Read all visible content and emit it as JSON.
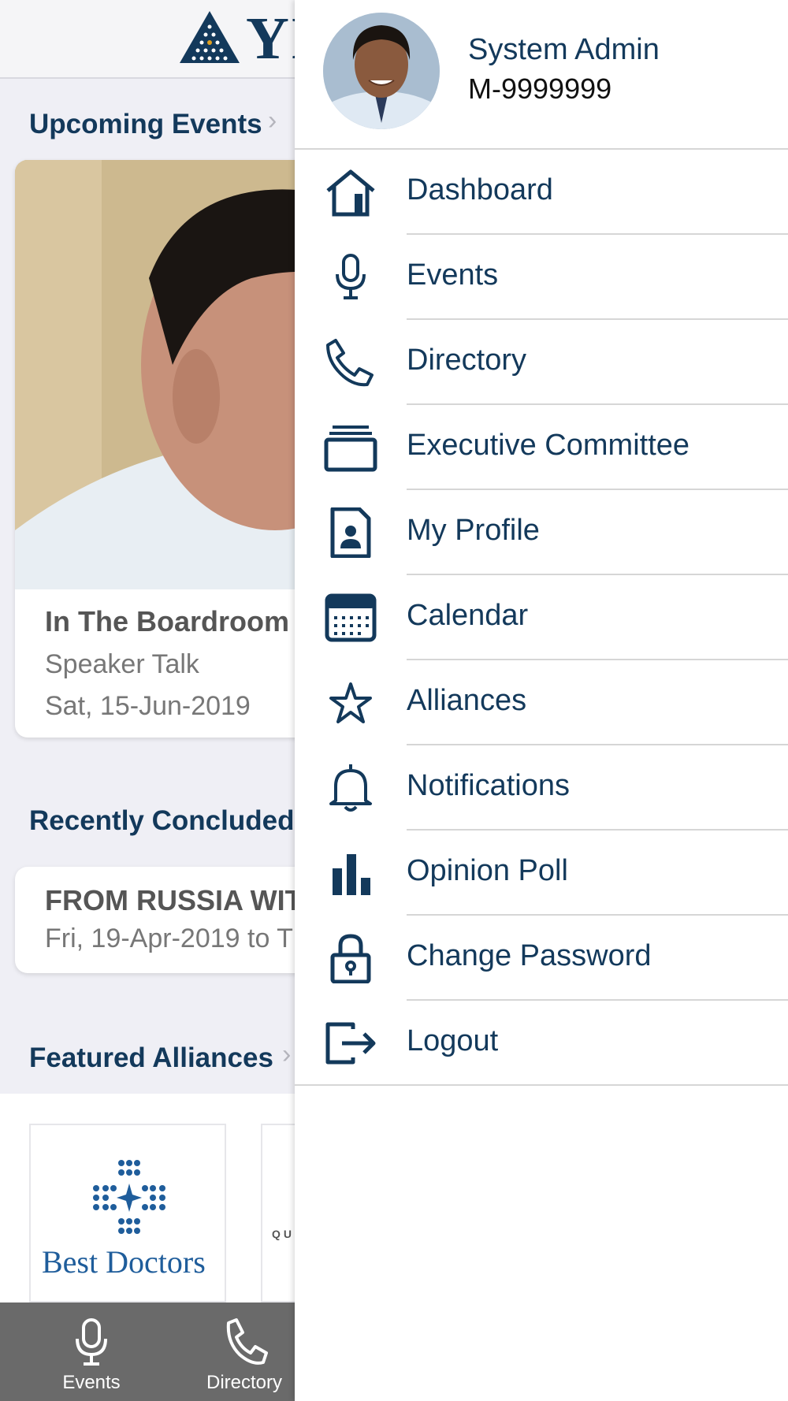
{
  "app": {
    "logo_text": "YI",
    "sections": {
      "upcoming": {
        "title": "Upcoming Events"
      },
      "concluded": {
        "title": "Recently Concluded"
      },
      "alliances": {
        "title": "Featured Alliances"
      }
    },
    "upcoming_event": {
      "title": "In The Boardroom",
      "type": "Speaker Talk",
      "date": "Sat, 15-Jun-2019"
    },
    "concluded_event": {
      "title": "FROM RUSSIA WIT",
      "date": "Fri, 19-Apr-2019 to T"
    },
    "alliances": [
      {
        "name": "Best Doctors"
      },
      {
        "name": "QU"
      }
    ],
    "bottom_nav": [
      {
        "label": "Events",
        "icon": "microphone-icon"
      },
      {
        "label": "Directory",
        "icon": "phone-icon"
      }
    ]
  },
  "drawer": {
    "user": {
      "name": "System Admin",
      "member_id": "M-9999999"
    },
    "menu": [
      {
        "label": "Dashboard",
        "icon": "home-icon"
      },
      {
        "label": "Events",
        "icon": "microphone-icon"
      },
      {
        "label": "Directory",
        "icon": "phone-icon"
      },
      {
        "label": "Executive Committee",
        "icon": "stack-icon"
      },
      {
        "label": "My Profile",
        "icon": "profile-document-icon"
      },
      {
        "label": "Calendar",
        "icon": "calendar-icon"
      },
      {
        "label": "Alliances",
        "icon": "star-icon"
      },
      {
        "label": "Notifications",
        "icon": "bell-icon"
      },
      {
        "label": "Opinion Poll",
        "icon": "bar-chart-icon"
      },
      {
        "label": "Change Password",
        "icon": "lock-icon"
      },
      {
        "label": "Logout",
        "icon": "logout-icon"
      }
    ]
  },
  "colors": {
    "primary": "#13395b",
    "divider": "#d6d6d6",
    "background": "#efeff5",
    "bottom_nav": "#6a6a6a"
  }
}
